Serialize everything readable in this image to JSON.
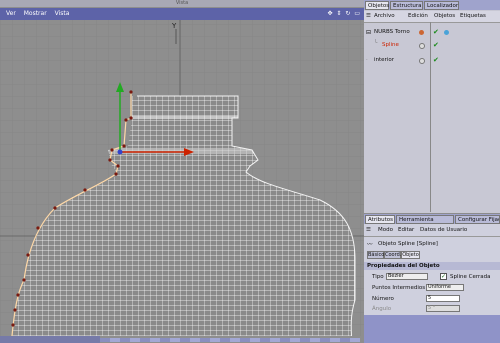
{
  "viewport": {
    "title": "Vista",
    "menu": [
      "Ver",
      "Mostrar",
      "Vista"
    ],
    "axis_label": "Y"
  },
  "object_manager": {
    "tabs": [
      "Objetos",
      "Estructura",
      "Localizador"
    ],
    "menu": [
      "Archivo",
      "Edición",
      "Objetos",
      "Etiquetas"
    ],
    "objects": [
      {
        "name": "NURBS Torno",
        "color": "#111111"
      },
      {
        "name": "Spline",
        "color": "#cc2200"
      },
      {
        "name": "interior",
        "color": "#111111"
      }
    ]
  },
  "attribute_manager": {
    "tabs": [
      "Atributos",
      "Herramienta Activa",
      "Configurar Fijac"
    ],
    "menu": [
      "Modo",
      "Editar",
      "Datos de Usuario"
    ],
    "object_title": "Objeto Spline [Spline]",
    "subtabs": [
      "Básico",
      "Coord.",
      "Objeto"
    ],
    "section": "Propiedades del Objeto",
    "tipo_label": "Tipo",
    "tipo_value": "Bezier",
    "cerrada_label": "Spline Cerrada",
    "puntos_label": "Puntos Intermedios",
    "puntos_value": "Uniforme",
    "numero_label": "Número",
    "numero_value": "5",
    "angulo_label": "Ángulo",
    "angulo_value": "5 °"
  },
  "colors": {
    "menubar": "#5d63a8",
    "panel_tab": "#9fa3cc",
    "spline": "#cc2200"
  }
}
